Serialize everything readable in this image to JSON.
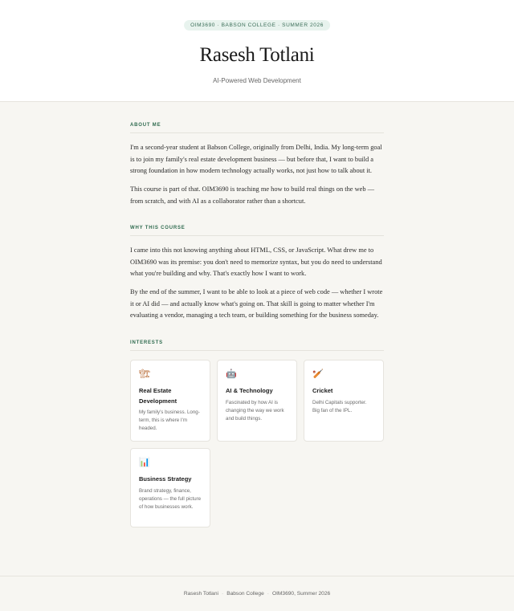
{
  "header": {
    "badge": "OIM3690 · BABSON COLLEGE · SUMMER 2026",
    "name": "Rasesh Totlani",
    "subtitle": "AI-Powered Web Development"
  },
  "about": {
    "label": "ABOUT ME",
    "paragraphs": [
      "I'm a second-year student at Babson College, originally from Delhi, India. My long-term goal is to join my family's real estate development business — but before that, I want to build a strong foundation in how modern technology actually works, not just how to talk about it.",
      "This course is part of that. OIM3690 is teaching me how to build real things on the web — from scratch, and with AI as a collaborator rather than a shortcut."
    ]
  },
  "why": {
    "label": "WHY THIS COURSE",
    "paragraphs": [
      "I came into this not knowing anything about HTML, CSS, or JavaScript. What drew me to OIM3690 was its premise: you don't need to memorize syntax, but you do need to understand what you're building and why. That's exactly how I want to work.",
      "By the end of the summer, I want to be able to look at a piece of web code — whether I wrote it or AI did — and actually know what's going on. That skill is going to matter whether I'm evaluating a vendor, managing a tech team, or building something for the business someday."
    ]
  },
  "interests": {
    "label": "INTERESTS",
    "cards": [
      {
        "icon": "construction-icon",
        "glyph": "🏗",
        "title": "Real Estate Development",
        "desc": "My family's business. Long-term, this is where I'm headed."
      },
      {
        "icon": "robot-icon",
        "glyph": "🤖",
        "title": "AI & Technology",
        "desc": "Fascinated by how AI is changing the way we work and build things."
      },
      {
        "icon": "cricket-icon",
        "glyph": "🏏",
        "title": "Cricket",
        "desc": "Delhi Capitals supporter. Big fan of the IPL."
      },
      {
        "icon": "bar-chart-icon",
        "glyph": "📊",
        "title": "Business Strategy",
        "desc": "Brand strategy, finance, operations — the full picture of how businesses work."
      }
    ]
  },
  "footer": {
    "name": "Rasesh Totlani",
    "school": "Babson College",
    "course": "OIM3690, Summer 2026",
    "separator": "·"
  },
  "colors": {
    "accent": "#2f6b4f",
    "background": "#f7f6f2",
    "badge_bg": "#e8f3ee"
  }
}
